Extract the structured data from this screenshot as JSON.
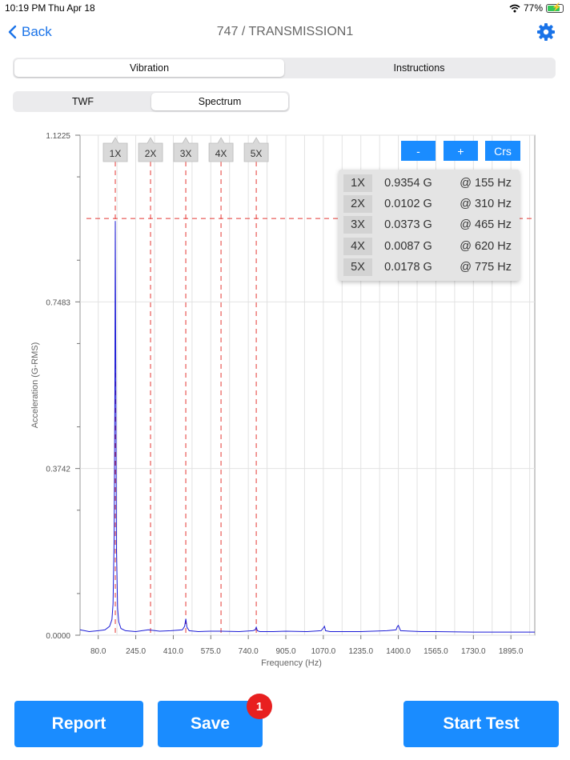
{
  "status": {
    "time": "10:19 PM",
    "date": "Thu Apr 18",
    "battery": "77%"
  },
  "nav": {
    "back_label": "Back",
    "title": "747 / TRANSMISSION1"
  },
  "tabs_main": [
    "Vibration",
    "Instructions"
  ],
  "tabs_sub": [
    "TWF",
    "Spectrum"
  ],
  "chart_controls": [
    "-",
    "+",
    "Crs"
  ],
  "harmonics": [
    {
      "label": "1X",
      "amp": "0.9354 G",
      "freq": "@ 155 Hz"
    },
    {
      "label": "2X",
      "amp": "0.0102 G",
      "freq": "@ 310 Hz"
    },
    {
      "label": "3X",
      "amp": "0.0373 G",
      "freq": "@ 465 Hz"
    },
    {
      "label": "4X",
      "amp": "0.0087 G",
      "freq": "@ 620 Hz"
    },
    {
      "label": "5X",
      "amp": "0.0178 G",
      "freq": "@ 775 Hz"
    }
  ],
  "chart_data": {
    "type": "line",
    "xlabel": "Frequency (Hz)",
    "ylabel": "Acceleration (G-RMS)",
    "x_ticks": [
      "80.0",
      "245.0",
      "410.0",
      "575.0",
      "740.0",
      "905.0",
      "1070.0",
      "1235.0",
      "1400.0",
      "1565.0",
      "1730.0",
      "1895.0"
    ],
    "y_ticks": [
      "0.0000",
      "0.3742",
      "0.7483",
      "1.1225"
    ],
    "xlim": [
      0,
      2000
    ],
    "ylim": [
      0,
      1.1225
    ],
    "grid": true,
    "cursor_level": 0.9354,
    "harmonic_freqs": [
      155,
      310,
      465,
      620,
      775
    ],
    "series": [
      {
        "color": "#1a1ad6",
        "x": [
          0,
          40,
          80,
          110,
          130,
          140,
          145,
          150,
          153,
          155,
          157,
          160,
          165,
          170,
          180,
          200,
          245,
          300,
          350,
          400,
          450,
          460,
          465,
          470,
          480,
          520,
          575,
          620,
          700,
          760,
          770,
          775,
          780,
          790,
          850,
          905,
          1000,
          1060,
          1070,
          1075,
          1080,
          1100,
          1235,
          1350,
          1390,
          1395,
          1400,
          1410,
          1500,
          1565,
          1730,
          1895,
          2000
        ],
        "y": [
          0.012,
          0.008,
          0.01,
          0.012,
          0.02,
          0.035,
          0.07,
          0.22,
          0.55,
          0.93,
          0.62,
          0.2,
          0.06,
          0.03,
          0.015,
          0.01,
          0.008,
          0.012,
          0.009,
          0.01,
          0.012,
          0.02,
          0.037,
          0.018,
          0.01,
          0.008,
          0.009,
          0.009,
          0.008,
          0.01,
          0.012,
          0.018,
          0.01,
          0.008,
          0.008,
          0.009,
          0.008,
          0.01,
          0.016,
          0.02,
          0.01,
          0.008,
          0.008,
          0.01,
          0.012,
          0.019,
          0.022,
          0.01,
          0.008,
          0.008,
          0.007,
          0.007,
          0.007
        ]
      }
    ]
  },
  "buttons": {
    "report": "Report",
    "save": "Save",
    "start": "Start Test",
    "save_badge": "1"
  },
  "colors": {
    "accent": "#1a8cff",
    "cursor": "#e53935",
    "badge": "#e82020"
  }
}
